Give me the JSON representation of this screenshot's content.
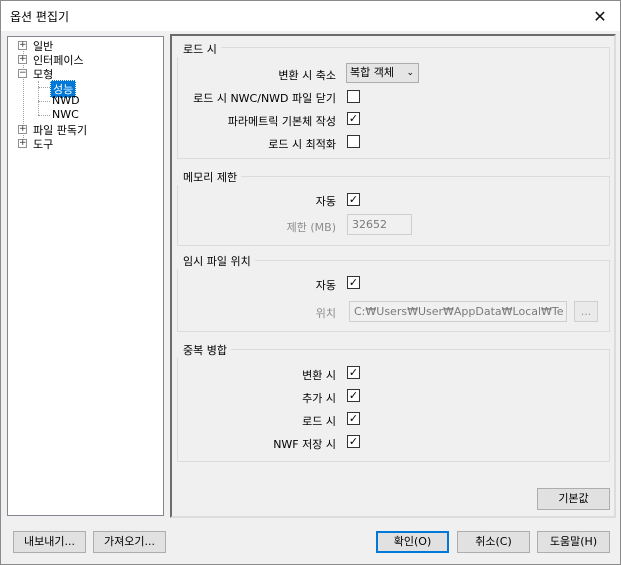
{
  "window": {
    "title": "옵션 편집기",
    "close_icon": "close-icon"
  },
  "tree": {
    "general": "일반",
    "interface": "인터페이스",
    "model": "모형",
    "performance": "성능",
    "nwd": "NWD",
    "nwc": "NWC",
    "file_readers": "파일 판독기",
    "tools": "도구"
  },
  "load_group": {
    "title": "로드 시",
    "convert_collapse_label": "변환 시 축소",
    "convert_collapse_value": "복합 객체",
    "close_nwc_nwd_label": "로드 시 NWC/NWD 파일 닫기",
    "close_nwc_nwd_checked": false,
    "create_parametric_label": "파라메트릭 기본체 작성",
    "create_parametric_checked": true,
    "optimize_label": "로드 시 최적화",
    "optimize_checked": false
  },
  "memory_group": {
    "title": "메모리 제한",
    "auto_label": "자동",
    "auto_checked": true,
    "limit_label": "제한 (MB)",
    "limit_value": "32652"
  },
  "temp_group": {
    "title": "임시 파일 위치",
    "auto_label": "자동",
    "auto_checked": true,
    "location_label": "위치",
    "location_value": "C:₩Users₩User₩AppData₩Local₩Te",
    "browse_label": "..."
  },
  "merge_group": {
    "title": "중복 병합",
    "on_convert_label": "변환 시",
    "on_convert_checked": true,
    "on_append_label": "추가 시",
    "on_append_checked": true,
    "on_load_label": "로드 시",
    "on_load_checked": true,
    "on_nwf_save_label": "NWF 저장 시",
    "on_nwf_save_checked": true
  },
  "buttons": {
    "defaults": "기본값",
    "export": "내보내기...",
    "import": "가져오기...",
    "ok": "확인(O)",
    "cancel": "취소(C)",
    "help": "도움말(H)"
  }
}
